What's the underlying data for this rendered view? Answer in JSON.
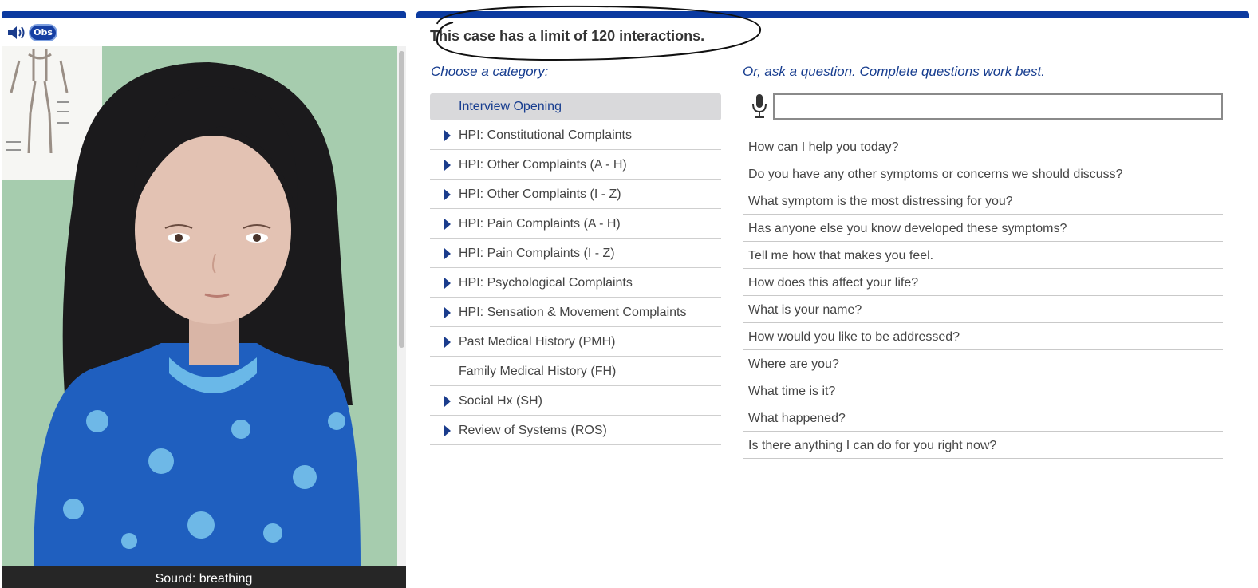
{
  "toolbar": {
    "obs_label": "Obs",
    "speaker_icon": "speaker-icon"
  },
  "sound_caption": "Sound: breathing",
  "limit_notice": "This case has a limit of 120 interactions.",
  "categories": {
    "heading": "Choose a category:",
    "items": [
      {
        "label": "Interview Opening",
        "active": true,
        "expandable": false
      },
      {
        "label": "HPI: Constitutional Complaints",
        "expandable": true
      },
      {
        "label": "HPI: Other Complaints (A - H)",
        "expandable": true
      },
      {
        "label": "HPI: Other Complaints (I - Z)",
        "expandable": true
      },
      {
        "label": "HPI: Pain Complaints (A - H)",
        "expandable": true
      },
      {
        "label": "HPI: Pain Complaints (I - Z)",
        "expandable": true
      },
      {
        "label": "HPI: Psychological Complaints",
        "expandable": true
      },
      {
        "label": "HPI: Sensation & Movement Complaints",
        "expandable": true
      },
      {
        "label": "Past Medical History (PMH)",
        "expandable": true
      },
      {
        "label": "Family Medical History (FH)",
        "expandable": false
      },
      {
        "label": "Social Hx (SH)",
        "expandable": true
      },
      {
        "label": "Review of Systems (ROS)",
        "expandable": true
      }
    ]
  },
  "ask": {
    "heading": "Or, ask a question. Complete questions work best.",
    "input_value": "",
    "mic_icon": "microphone-icon"
  },
  "questions": [
    "How can I help you today?",
    "Do you have any other symptoms or concerns we should discuss?",
    "What symptom is the most distressing for you?",
    "Has anyone else you know developed these symptoms?",
    "Tell me how that makes you feel.",
    "How does this affect your life?",
    "What is your name?",
    "How would you like to be addressed?",
    "Where are you?",
    "What time is it?",
    "What happened?",
    "Is there anything I can do for you right now?"
  ],
  "colors": {
    "accent": "#0b3aa0",
    "heading": "#173d8f",
    "wall": "#a7cdb0",
    "shirt": "#1f5fbf"
  }
}
